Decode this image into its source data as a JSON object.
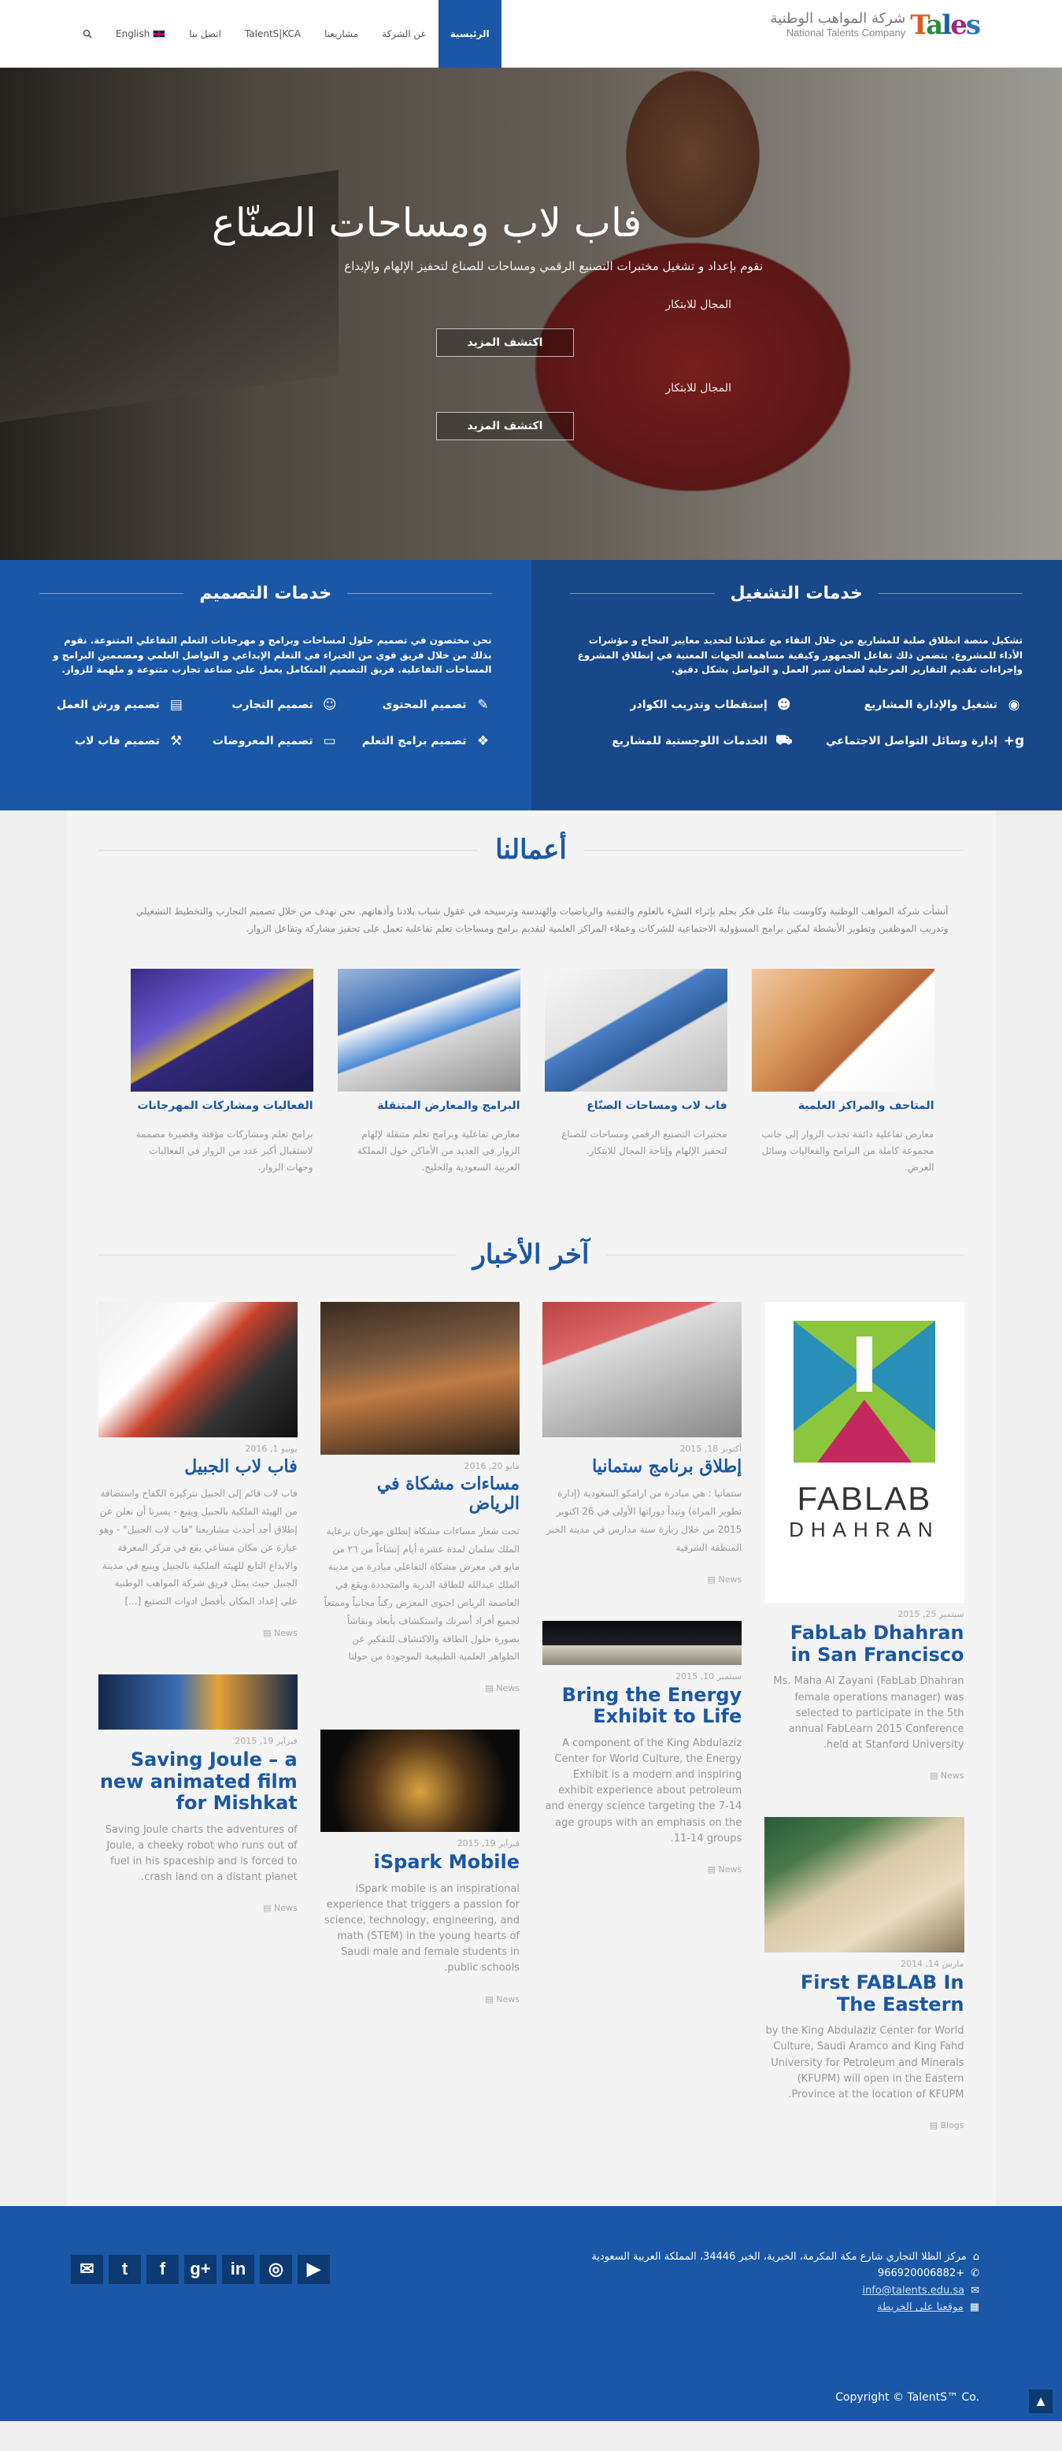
{
  "header": {
    "logo_mark": [
      "T",
      "a",
      "l",
      "e",
      "s"
    ],
    "logo_ar": "شركة المواهب الوطنية",
    "logo_en": "National Talents Company",
    "nav": [
      {
        "label": "الرئيسية",
        "active": true
      },
      {
        "label": "عن الشركة"
      },
      {
        "label": "مشاريعنا"
      },
      {
        "label": "TalentS|KCA"
      },
      {
        "label": "اتصل بنا"
      },
      {
        "label": "English"
      }
    ],
    "search_icon": "search-icon"
  },
  "hero": {
    "title": "فاب لاب ومساحات الصنّاع",
    "subtitle": "نقوم بإعداد و تشغيل مختبرات التصنيع الرقمي ومساحات للصناع لتحفيز الإلهام والإبداع",
    "field_1": "المجال للابتكار",
    "button_1": "اكتشف المزيد",
    "field_2": "المجال للابتكار",
    "button_2": "اكتشف المزيد"
  },
  "services": {
    "design": {
      "title": "خدمات التصميم",
      "description": "نحن مختصون في تصميم حلول لمساحات وبرامج و مهرجانات التعلم التفاعلي المتنوعة. نقوم بذلك من خلال فريق قوي من الخبراء في التعلم الإبداعي و التواصل العلمي ومصممين البرامج و المساحات التفاعلية. فريق التصميم المتكامل يعمل على صناعة تجارب متنوعة و ملهمة للزوار.",
      "items": [
        {
          "label": "تصميم المحتوى",
          "icon": "pencil-icon"
        },
        {
          "label": "تصميم التجارب",
          "icon": "users-icon"
        },
        {
          "label": "تصميم ورش العمل",
          "icon": "clipboard-icon"
        },
        {
          "label": "تصميم برامج التعلم",
          "icon": "cubes-icon"
        },
        {
          "label": "تصميم المعروضات",
          "icon": "laptop-icon"
        },
        {
          "label": "تصميم فاب لاب",
          "icon": "gavel-icon"
        }
      ]
    },
    "operation": {
      "title": "خدمات التشغيل",
      "description": "تشكيل منصة انطلاق صلبة للمشاريع من خلال التقاء مع عملائنا لتحديد معايير النجاح و مؤشرات الأداء للمشروع. يتضمن ذلك تفاعل الجمهور وكيفية مساهمة الجهات المعنية في إنطلاق المشروع وإجراءات تقديم التقارير المرحلية لضمان سير العمل و التواصل بشكل دقيق.",
      "items": [
        {
          "label": "تشغيل والإدارة المشاريع",
          "icon": "eye-icon"
        },
        {
          "label": "إستقطاب وتدريب الكوادر",
          "icon": "user-group-icon"
        },
        {
          "label": "إدارة وسائل التواصل الاجتماعي",
          "icon": "google-plus-icon"
        },
        {
          "label": "الخدمات اللوجستية للمشاريع",
          "icon": "truck-icon"
        }
      ]
    }
  },
  "works": {
    "title": "أعمالنا",
    "intro": "أنشأت شركة المواهب الوطنية وكاوست بناءً على فكر يحلم بإثراء النشء بالعلوم والتقنية والرياضيات والهندسة وترسيخه في عقول شباب بلادنا وأذهانهم. نحن نهدف من خلال تصميم التجارب والتخطيط التشغيلي وتدريب الموظفين وتطوير الأنشطة لمكين برامج المسؤولية الاجتماعية للشركات وعملاء المراكز العلمية لتقديم برامج ومساحات تعلم تفاعلية تعمل على تحفيز مشاركة وتفاعل الزوار.",
    "items": [
      {
        "title": "المتاحف والمراكز العلمية",
        "desc": "معارض تفاعلية دائمة تجذب الزوار إلى جانب مجموعة كاملة من البرامج والفعاليات وسائل العرض."
      },
      {
        "title": "فاب لاب ومساحات الصنّاع",
        "desc": "مختبرات التصنيع الرقمي ومساحات للصناع لتحفيز الإلهام وإتاحة المجال للابتكار."
      },
      {
        "title": "البرامج والمعارض المتنقلة",
        "desc": "معارض تفاعلية وبرامج تعلم متنقلة لإلهام الزوار في العديد من الأماكن حول المملكة العربية السعودية والخليج."
      },
      {
        "title": "الفعاليات ومشاركات المهرجانات",
        "desc": "برامج تعلم ومشاركات مؤقتة وقصيرة مصممة لاستقبال أكبر عدد من الزوار في الفعاليات وجهات الزوار."
      }
    ]
  },
  "news": {
    "title": "آخر الأخبار",
    "col1": [
      {
        "date": "سبتمبر 25, 2015",
        "title": "FabLab Dhahran in San Francisco",
        "text": "Ms. Maha Al Zayani (FabLab Dhahran female operations manager) was selected to participate in the 5th annual FabLearn 2015 Conference held at Stanford University.",
        "meta": "News"
      },
      {
        "date": "مارس 14, 2014",
        "title": "First FABLAB In The Eastern",
        "text": "by the King Abdulaziz Center for World Culture, Saudi Aramco and King Fahd University for Petroleum and Minerals (KFUPM) will open in the Eastern Province at the location of KFUPM.",
        "meta": "Blogs"
      }
    ],
    "col2": [
      {
        "date": "أكتوبر 18, 2015",
        "title": "إطلاق برنامج ستمانيا",
        "text": "ستمانيا : هي مبادرة من ارامكو السعودية (إدارة تطوير المراة) وتبدأ دوراتها الأولى في 26 اكتوبر 2015 من خلال زيارة ستة مدارس في مدينة الخبر المنطقة الشرقية",
        "meta": "News"
      },
      {
        "date": "سبتمبر 10, 2015",
        "title": "Bring the Energy Exhibit to Life",
        "text": "A component of the King Abdulaziz Center for World Culture, the Energy Exhibit is a modern and inspiring exhibit experience about petroleum and energy science targeting the 7-14 age groups with an emphasis on the 11-14 groups.",
        "meta": "News"
      }
    ],
    "col3": [
      {
        "date": "مايو 20, 2016",
        "title": "مساءات مشكاة في الرياض",
        "text": "تحت شعار مساءات مشكاة إنطلق مهرجان برعاية الملك سلمان لمدة عشرة أيام إنشاءاً من ٢٦ من مايو في معرض مشكاة التفاعلي مبادرة من مدينة الملك عبدالله للطاقة الذرية والمتجددة ويقع في العاصمة الرياض احتوى المعرض ركناً مجانياً وممتعاً لجميع أفراد أسرتك واستكشاف بأبعاد ونقاشاً بصورة حلول الطاقة والاكتشاف للتفكير عن الظواهر العلمية الطبيعية الموجودة من حولنا",
        "meta": "News"
      },
      {
        "date": "فبراير 19, 2015",
        "title": "iSpark Mobile",
        "text": "iSpark mobile is an inspirational experience that triggers a passion for science, technology, engineering, and math (STEM) in the young hearts of Saudi male and female students in public schools.",
        "meta": "News"
      }
    ],
    "col4": [
      {
        "date": "يونيو 1, 2016",
        "title": "فاب لاب الجبيل",
        "text": "فاب لاب قائم إلى الجبيل نتركيزه الكفاح واستضافة من الهيئة الملكية بالجبيل وينبع - يسرنا أن نعلن عن إطلاق أحد أحدث مشاريعنا \"فاب لاب الجبيل\" - وهو عبارة عن مكان مساعي يقع في مركز المعرفة والابداع التابع للهيئة الملكية بالجبيل وينبع في مدينة الجبيل حيث يمثل فريق شركة المواهب الوطنية على إعداد المكان بأفضل ادوات التصنيع [...]",
        "meta": "News"
      },
      {
        "date": "فبراير 19, 2015",
        "title": "Saving Joule – a new animated film for Mishkat",
        "text": "Saving Joule charts the adventures of Joule, a cheeky robot who runs out of fuel in his spaceship and is forced to crash land on a distant planet.",
        "meta": "News"
      }
    ],
    "fablab_logo": {
      "top": "FABLAB",
      "bottom": "DHAHRAN"
    }
  },
  "footer": {
    "address": "مركز الظلا التجاري شارع مكة المكرمة، الخبرية، الخبر 34446، المملكة العربية السعودية",
    "phone": "+966920006882",
    "email": "info@talents.edu.sa",
    "map": "موقعنا على الخريطة",
    "social": [
      {
        "name": "email",
        "glyph": "✉",
        "bg": "#0d3a73"
      },
      {
        "name": "twitter",
        "glyph": "t",
        "bg": "#0d3a73"
      },
      {
        "name": "facebook",
        "glyph": "f",
        "bg": "#0d3a73"
      },
      {
        "name": "google-plus",
        "glyph": "g+",
        "bg": "#0d3a73"
      },
      {
        "name": "linkedin",
        "glyph": "in",
        "bg": "#0d3a73"
      },
      {
        "name": "instagram",
        "glyph": "◎",
        "bg": "#0d3a73"
      },
      {
        "name": "youtube",
        "glyph": "▶",
        "bg": "#0d3a73"
      }
    ],
    "copyright": "Copyright © TalentS™ Co."
  },
  "colors": {
    "primary": "#1a57a6",
    "dark": "#18478a"
  }
}
